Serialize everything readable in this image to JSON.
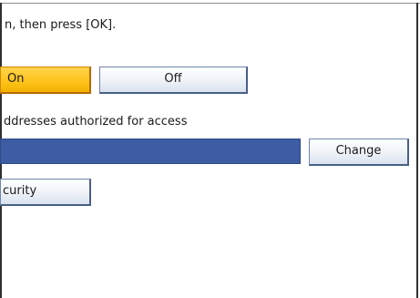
{
  "instruction": "n, then press [OK].",
  "toggle": {
    "on_label": "On",
    "off_label": "Off"
  },
  "access": {
    "label": "ddresses authorized for access",
    "change_label": "Change"
  },
  "security_button_label": "curity"
}
